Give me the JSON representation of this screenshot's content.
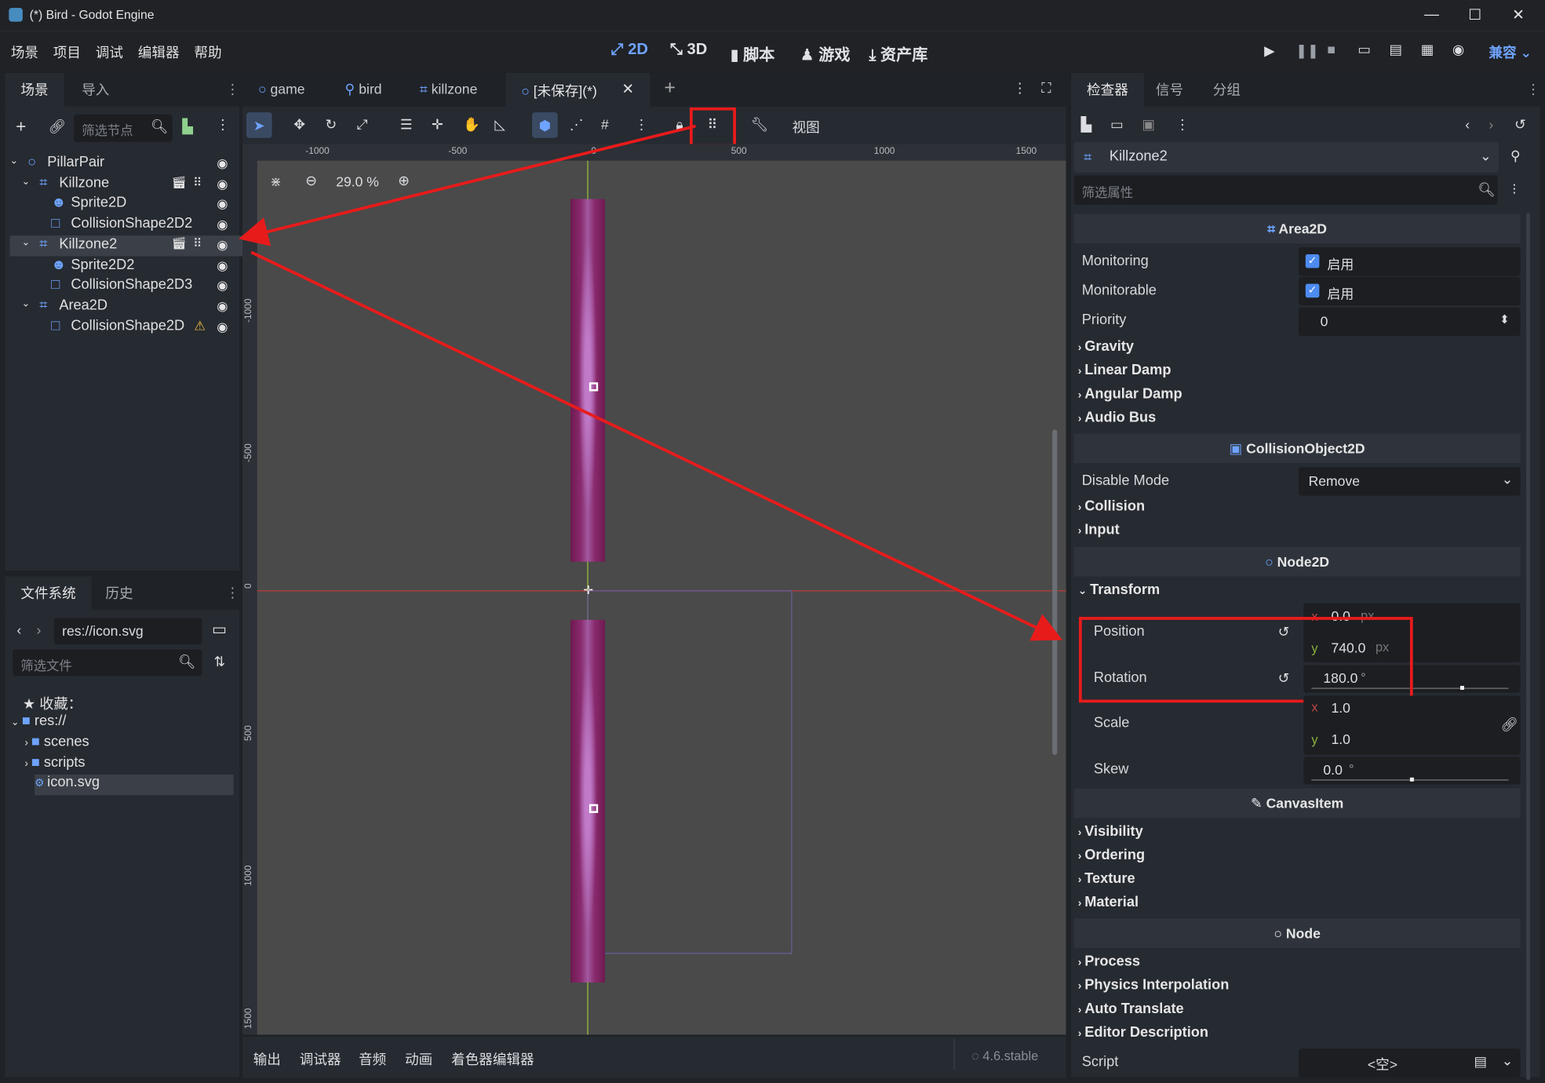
{
  "window": {
    "title": "(*) Bird - Godot Engine"
  },
  "menu": [
    "场景",
    "项目",
    "调试",
    "编辑器",
    "帮助"
  ],
  "modes": [
    "2D",
    "3D",
    "脚本",
    "游戏",
    "资产库"
  ],
  "renderer": "兼容",
  "scene_panel": {
    "tabs": [
      "场景",
      "导入"
    ],
    "filter_placeholder": "筛选节点",
    "tree": [
      {
        "label": "PillarPair",
        "icon": "node2d-icon"
      },
      {
        "label": "Killzone",
        "icon": "area2d-icon"
      },
      {
        "label": "Sprite2D",
        "icon": "sprite2d-icon"
      },
      {
        "label": "CollisionShape2D2",
        "icon": "collisionshape-icon"
      },
      {
        "label": "Killzone2",
        "icon": "area2d-icon"
      },
      {
        "label": "Sprite2D2",
        "icon": "sprite2d-icon"
      },
      {
        "label": "CollisionShape2D3",
        "icon": "collisionshape-icon"
      },
      {
        "label": "Area2D",
        "icon": "area2d-icon"
      },
      {
        "label": "CollisionShape2D",
        "icon": "collisionshape-icon"
      }
    ]
  },
  "fs_panel": {
    "tabs": [
      "文件系统",
      "历史"
    ],
    "path": "res://icon.svg",
    "filter_placeholder": "筛选文件",
    "items": [
      "收藏：",
      "res://",
      "scenes",
      "scripts",
      "icon.svg"
    ]
  },
  "editor_tabs": [
    "game",
    "bird",
    "killzone",
    "[未保存](*)"
  ],
  "toolbar": {
    "view_label": "视图"
  },
  "viewport": {
    "zoom": "29.0 %",
    "hruler": [
      "-1000",
      "-500",
      "0",
      "500",
      "1000",
      "1500"
    ],
    "vruler": [
      "-1000",
      "-500",
      "0",
      "500",
      "1000",
      "1500"
    ]
  },
  "bottom": {
    "tabs": [
      "输出",
      "调试器",
      "音频",
      "动画",
      "着色器编辑器"
    ],
    "version": "4.6.stable"
  },
  "inspector": {
    "tabs": [
      "检查器",
      "信号",
      "分组"
    ],
    "node": "Killzone2",
    "filter_placeholder": "筛选属性",
    "sections": {
      "area2d": "Area2D",
      "collisionobject": "CollisionObject2D",
      "node2d": "Node2D",
      "canvasitem": "CanvasItem",
      "node": "Node"
    },
    "monitoring_label": "Monitoring",
    "monitorable_label": "Monitorable",
    "enabled_text": "启用",
    "priority_label": "Priority",
    "priority_value": "0",
    "area_groups": [
      "Gravity",
      "Linear Damp",
      "Angular Damp",
      "Audio Bus"
    ],
    "disable_mode_label": "Disable Mode",
    "disable_mode_value": "Remove",
    "collision_groups": [
      "Collision",
      "Input"
    ],
    "transform_label": "Transform",
    "position_label": "Position",
    "position_x": "0.0",
    "position_y": "740.0",
    "unit_px": "px",
    "rotation_label": "Rotation",
    "rotation_value": "180.0",
    "rotation_unit": "°",
    "scale_label": "Scale",
    "scale_x": "1.0",
    "scale_y": "1.0",
    "skew_label": "Skew",
    "skew_value": "0.0",
    "axis_x": "x",
    "axis_y": "y",
    "canvas_groups": [
      "Visibility",
      "Ordering",
      "Texture",
      "Material"
    ],
    "node_groups": [
      "Process",
      "Physics Interpolation",
      "Auto Translate",
      "Editor Description"
    ],
    "script_label": "Script",
    "script_value": "<空>"
  },
  "colors": {
    "accent": "#6ea3ff",
    "highlight_red": "#e81b1b",
    "pillar": "#7a1f5c"
  }
}
